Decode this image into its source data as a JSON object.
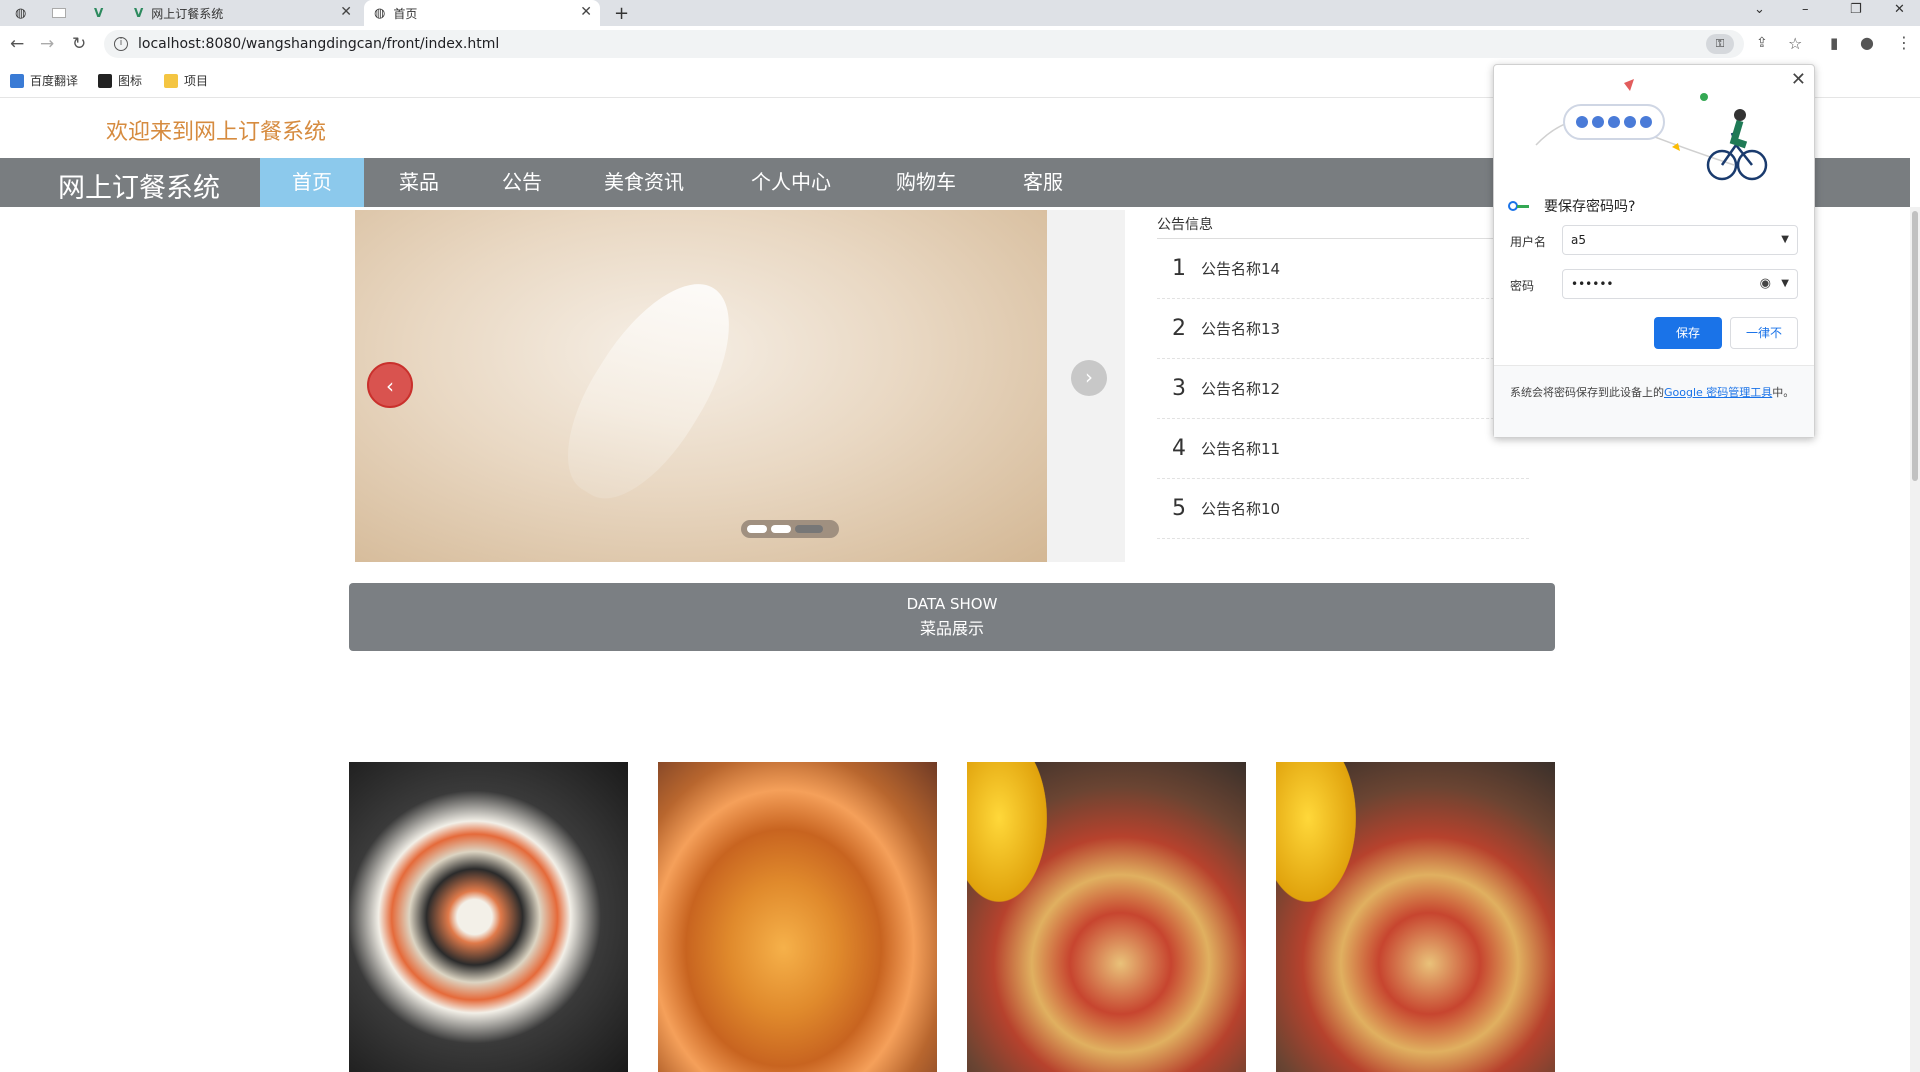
{
  "browser": {
    "tabs": [
      {
        "title": ""
      },
      {
        "title": ""
      },
      {
        "title": ""
      },
      {
        "title": "网上订餐系统"
      },
      {
        "title": "首页"
      }
    ],
    "new_tab_label": "+",
    "url": "localhost:8080/wangshangdingcan/front/index.html",
    "bookmarks": [
      {
        "label": "百度翻译"
      },
      {
        "label": "图标"
      },
      {
        "label": "项目"
      }
    ]
  },
  "site": {
    "welcome": "欢迎来到网上订餐系统",
    "brand": "网上订餐系统",
    "nav": [
      {
        "label": "首页",
        "active": true
      },
      {
        "label": "菜品"
      },
      {
        "label": "公告"
      },
      {
        "label": "美食资讯"
      },
      {
        "label": "个人中心"
      },
      {
        "label": "购物车"
      },
      {
        "label": "客服"
      }
    ],
    "notice_title": "公告信息",
    "notices": [
      {
        "num": "1",
        "name": "公告名称14"
      },
      {
        "num": "2",
        "name": "公告名称13"
      },
      {
        "num": "3",
        "name": "公告名称12"
      },
      {
        "num": "4",
        "name": "公告名称11"
      },
      {
        "num": "5",
        "name": "公告名称10"
      }
    ],
    "datashow_en": "DATA SHOW",
    "datashow_cn": "菜品展示",
    "carousel_dots": 3,
    "carousel_current": 3
  },
  "password_popup": {
    "title": "要保存密码吗?",
    "username_label": "用户名",
    "username_value": "a5",
    "password_label": "密码",
    "password_value": "••••••",
    "save_label": "保存",
    "never_label": "一律不",
    "footer_text": "系统会将密码保存到此设备上的",
    "footer_link": "Google 密码管理工具",
    "footer_end": "中。"
  },
  "colors": {
    "nav_bg": "#797d80",
    "nav_active": "#8cc9ec",
    "welcome": "#d68b3f",
    "accent_blue": "#1a73e8"
  }
}
